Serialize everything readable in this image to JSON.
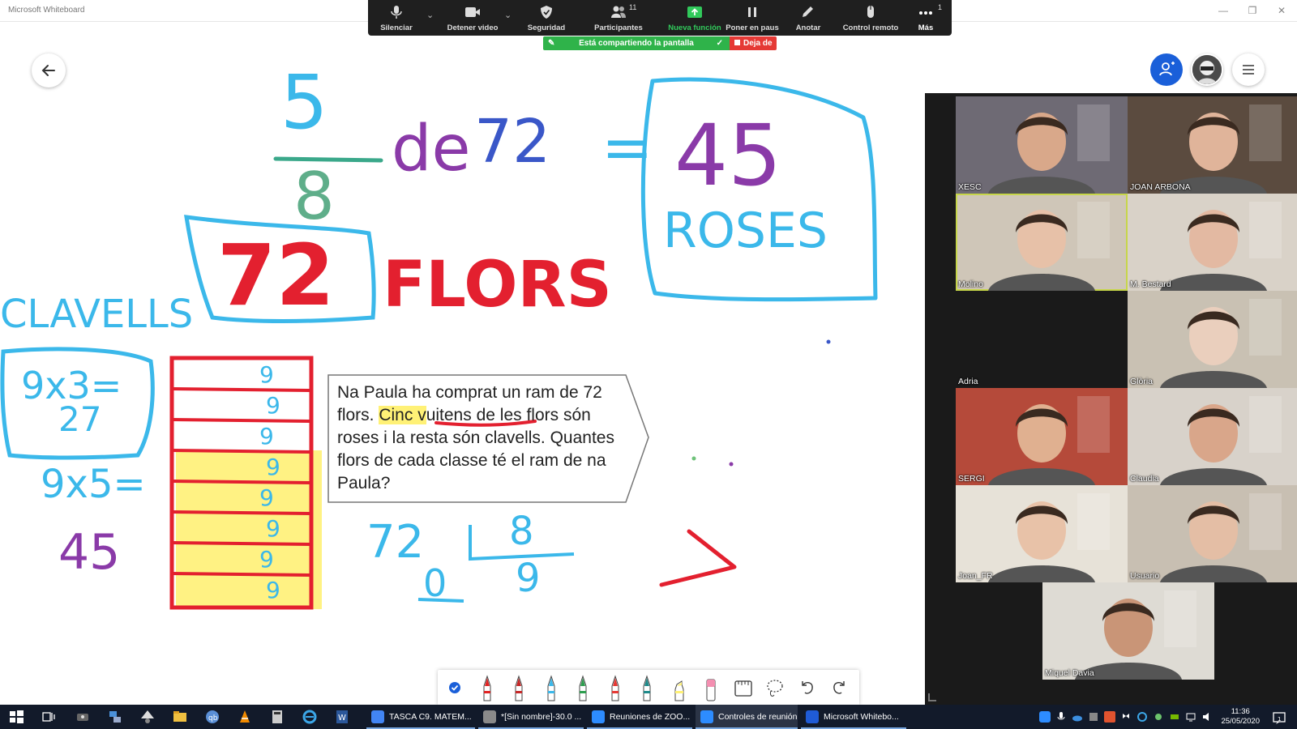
{
  "window": {
    "title": "Microsoft Whiteboard"
  },
  "zoom_controls": {
    "buttons": [
      {
        "id": "mute",
        "label": "Silenciar"
      },
      {
        "id": "video",
        "label": "Detener video"
      },
      {
        "id": "security",
        "label": "Seguridad"
      },
      {
        "id": "participants",
        "label": "Participantes",
        "count": "11"
      },
      {
        "id": "share",
        "label": "Nueva función"
      },
      {
        "id": "pause",
        "label": "Poner en paus"
      },
      {
        "id": "annotate",
        "label": "Anotar"
      },
      {
        "id": "remote",
        "label": "Control remoto"
      },
      {
        "id": "more",
        "label": "Más",
        "count": "1"
      }
    ],
    "sharing_status": "Está compartiendo la pantalla",
    "stop_label": "Deja de",
    "accent_green": "#2fb34a",
    "stop_red": "#e53935"
  },
  "whiteboard": {
    "handwriting": {
      "fraction_numerator": "5",
      "fraction_denominator": "8",
      "of_text": "de",
      "total": "72",
      "equals": "=",
      "result": "45",
      "roses_label": "ROSES",
      "flowers_total": "72",
      "flowers_label": "FLORS",
      "carnations_label": "CLAVELLS",
      "calc_1_line1": "9x3=",
      "calc_1_line2": "27",
      "calc_2": "9x5=",
      "calc_2_result": "45",
      "bar_cell_value": "9",
      "division_dividend": "72",
      "division_divisor": "8",
      "division_remainder": "0",
      "division_quotient": "9"
    },
    "bar_cells": 8,
    "highlighted_cells": 5,
    "problem": {
      "part1": "Na Paula ha comprat un ram de 72 flors. ",
      "highlight1": "Cinc v",
      "highlight2": "uitens",
      "part2": " de les flors són roses i la resta són clavells. Quantes flors de cada classe té el ram de na Paula?"
    },
    "ink_colors": {
      "blue": "#3bb8ea",
      "red": "#e3202f",
      "purple": "#8a3aa8",
      "yellow": "#fff176",
      "teal": "#3aa88a"
    }
  },
  "draw_tools": [
    {
      "id": "select",
      "icon": "check-circle-icon"
    },
    {
      "id": "pen-red-1",
      "icon": "pen-icon",
      "color": "#e02424"
    },
    {
      "id": "pen-red-2",
      "icon": "pen-icon",
      "color": "#c62828"
    },
    {
      "id": "pen-blue",
      "icon": "pen-icon",
      "color": "#3bb8ea"
    },
    {
      "id": "pen-green",
      "icon": "pen-icon",
      "color": "#2e9e4f"
    },
    {
      "id": "pen-red-3",
      "icon": "pen-icon",
      "color": "#e53935"
    },
    {
      "id": "pen-teal",
      "icon": "pen-icon",
      "color": "#1f8a8a"
    },
    {
      "id": "highlighter",
      "icon": "highlighter-icon",
      "color": "#fff176"
    },
    {
      "id": "eraser",
      "icon": "eraser-icon",
      "color": "#f48fb1"
    },
    {
      "id": "ruler",
      "icon": "ruler-icon"
    },
    {
      "id": "lasso",
      "icon": "lasso-icon"
    },
    {
      "id": "undo",
      "icon": "undo-icon"
    },
    {
      "id": "redo",
      "icon": "redo-icon"
    }
  ],
  "participants": [
    {
      "name": "XESC",
      "bg": "#6e6a74",
      "skin": "#d9a88a"
    },
    {
      "name": "JOAN ARBONA",
      "bg": "#5b4b3f",
      "skin": "#e0b49a"
    },
    {
      "name": "Molino",
      "bg": "#cfc6b8",
      "skin": "#e7c1a8"
    },
    {
      "name": "M. Bestard",
      "bg": "#d9d2c8",
      "skin": "#e3b9a2"
    },
    {
      "name": "Adria",
      "bg": "#1a1a1a",
      "skin": ""
    },
    {
      "name": "Glòria",
      "bg": "#c9c1b3",
      "skin": "#eacfbd"
    },
    {
      "name": "SERGI",
      "bg": "#b54a3a",
      "skin": "#e0b090"
    },
    {
      "name": "Claudia",
      "bg": "#d8d2ca",
      "skin": "#d9a68a"
    },
    {
      "name": "Joan_FR",
      "bg": "#e7e2d8",
      "skin": "#e8c2a8"
    },
    {
      "name": "Usuario",
      "bg": "#c8bfb2",
      "skin": "#e4bea5"
    },
    {
      "name": "Miquel Davia",
      "bg": "#dedbd4",
      "skin": "#c99577"
    }
  ],
  "taskbar": {
    "apps": [
      {
        "label": "TASCA C9. MATEM...",
        "color": "#4285f4"
      },
      {
        "label": "*[Sin nombre]-30.0 ...",
        "color": "#8a8a8a"
      },
      {
        "label": "Reuniones de ZOO...",
        "color": "#2d8cff"
      },
      {
        "label": "Controles de reunión",
        "color": "#2d8cff"
      },
      {
        "label": "Microsoft Whitebo...",
        "color": "#1f5bd6"
      }
    ],
    "time": "11:36",
    "date": "25/05/2020"
  }
}
